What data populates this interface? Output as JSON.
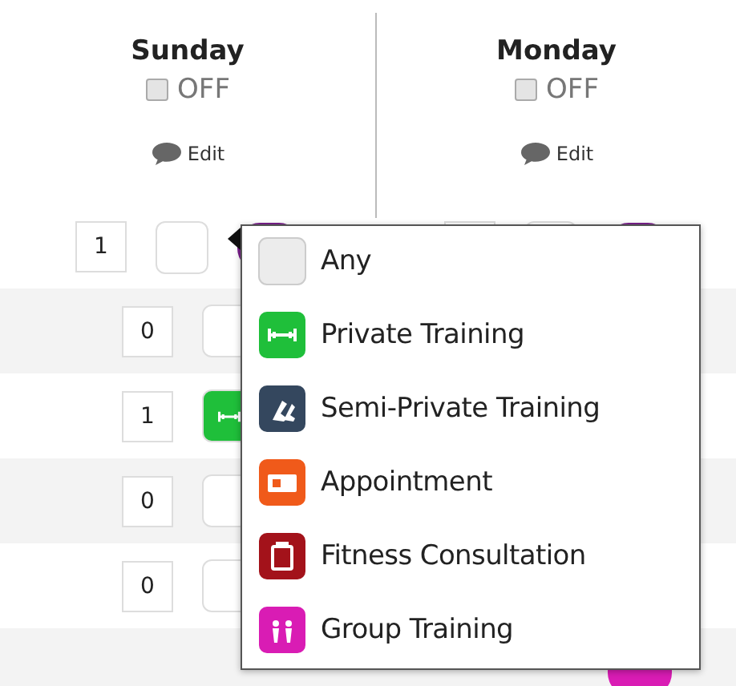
{
  "days": [
    {
      "name": "Sunday",
      "off": {
        "label": "OFF",
        "checked": false
      },
      "edit": "Edit",
      "slots": [
        {
          "count": "1",
          "kind": "empty",
          "color": "#7a1f8c"
        },
        {
          "count": "0",
          "kind": "empty"
        },
        {
          "count": "1",
          "kind": "private"
        },
        {
          "count": "0",
          "kind": "empty"
        },
        {
          "count": "0",
          "kind": "empty"
        }
      ]
    },
    {
      "name": "Monday",
      "off": {
        "label": "OFF",
        "checked": false
      },
      "edit": "Edit",
      "slots": [
        {
          "kind": "empty",
          "color": "#7a1f8c"
        },
        {
          "kind": "covered"
        },
        {
          "kind": "covered"
        },
        {
          "kind": "covered"
        },
        {
          "kind": "covered"
        },
        {
          "kind": "covered",
          "color": "#d91cb4"
        }
      ]
    }
  ],
  "type_menu": {
    "items": [
      {
        "kind": "any",
        "label": "Any",
        "color": "#ececec"
      },
      {
        "kind": "private",
        "label": "Private Training",
        "color": "#1fbf3a"
      },
      {
        "kind": "semi",
        "label": "Semi-Private Training",
        "color": "#34475e"
      },
      {
        "kind": "appointment",
        "label": "Appointment",
        "color": "#f05a1a"
      },
      {
        "kind": "consultation",
        "label": "Fitness Consultation",
        "color": "#a3121a"
      },
      {
        "kind": "group",
        "label": "Group Training",
        "color": "#d91cb4"
      }
    ]
  }
}
